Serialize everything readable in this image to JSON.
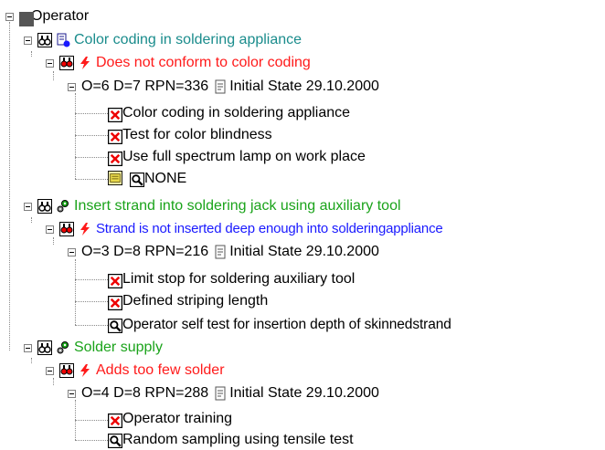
{
  "tree": {
    "root": {
      "label": "Operator",
      "icon": "square-node-icon"
    },
    "functions": [
      {
        "label": "Color coding in soldering appliance",
        "color": "#1a8c8c",
        "icon": "document-arrow-icon",
        "failure": {
          "label": "Does not conform to color coding",
          "color": "#ff1a1a",
          "rating": {
            "label": "O=6 D=7 RPN=336",
            "state": "Initial State 29.10.2000"
          },
          "measures": [
            {
              "label": "Color coding in soldering appliance",
              "icon": "prevention-x-icon"
            },
            {
              "label": "Test for color blindness",
              "icon": "prevention-x-icon"
            },
            {
              "label": "Use full spectrum lamp on work place",
              "icon": "prevention-x-icon"
            },
            {
              "label": "NONE",
              "icon": "detection-magnifier-icon",
              "extra_icon": "note-icon"
            }
          ]
        }
      },
      {
        "label": "Insert strand into soldering jack using auxiliary tool",
        "color": "#1aa31a",
        "icon": "gear-pair-icon",
        "failure": {
          "label": "Strand is not inserted deep enough into solderingappliance",
          "color": "#1a1aff",
          "rating": {
            "label": "O=3 D=8 RPN=216",
            "state": "Initial State 29.10.2000"
          },
          "measures": [
            {
              "label": "Limit stop for soldering auxiliary tool",
              "icon": "prevention-x-icon"
            },
            {
              "label": "Defined striping length",
              "icon": "prevention-x-icon"
            },
            {
              "label": "Operator self test for insertion depth of skinnedstrand",
              "icon": "detection-magnifier-icon"
            }
          ]
        }
      },
      {
        "label": "Solder supply",
        "color": "#1aa31a",
        "icon": "gear-pair-icon",
        "failure": {
          "label": "Adds too few solder",
          "color": "#ff1a1a",
          "rating": {
            "label": "O=4 D=8 RPN=288",
            "state": "Initial State 29.10.2000"
          },
          "measures": [
            {
              "label": "Operator training",
              "icon": "prevention-x-icon"
            },
            {
              "label": "Random sampling using tensile test",
              "icon": "detection-magnifier-icon"
            }
          ]
        }
      }
    ]
  }
}
